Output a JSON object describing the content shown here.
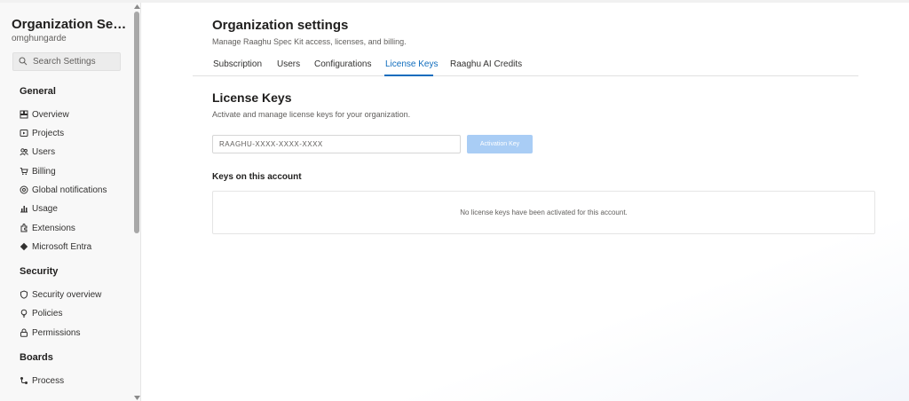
{
  "sidebar": {
    "org_title": "Organization Settin...",
    "org_subtitle": "omghungarde",
    "search_placeholder": "Search Settings",
    "sections": {
      "general": "General",
      "security": "Security",
      "boards": "Boards"
    },
    "general_items": [
      {
        "label": "Overview",
        "icon": "overview-icon"
      },
      {
        "label": "Projects",
        "icon": "projects-icon"
      },
      {
        "label": "Users",
        "icon": "users-icon"
      },
      {
        "label": "Billing",
        "icon": "billing-cart-icon"
      },
      {
        "label": "Global notifications",
        "icon": "notifications-icon"
      },
      {
        "label": "Usage",
        "icon": "usage-chart-icon"
      },
      {
        "label": "Extensions",
        "icon": "extensions-icon"
      },
      {
        "label": "Microsoft Entra",
        "icon": "entra-diamond-icon"
      }
    ],
    "security_items": [
      {
        "label": "Security overview",
        "icon": "shield-icon"
      },
      {
        "label": "Policies",
        "icon": "policies-bulb-icon"
      },
      {
        "label": "Permissions",
        "icon": "lock-icon"
      }
    ],
    "boards_items": [
      {
        "label": "Process",
        "icon": "process-icon"
      }
    ]
  },
  "header": {
    "title": "Organization settings",
    "description": "Manage Raaghu Spec Kit access, licenses, and billing."
  },
  "tabs": [
    {
      "label": "Subscription",
      "active": false
    },
    {
      "label": "Users",
      "active": false
    },
    {
      "label": "Configurations",
      "active": false
    },
    {
      "label": "License Keys",
      "active": true
    },
    {
      "label": "Raaghu AI Credits",
      "active": false
    }
  ],
  "license": {
    "title": "License Keys",
    "description": "Activate and manage license keys for your organization.",
    "input_placeholder": "RAAGHU-XXXX-XXXX-XXXX",
    "button_label": "Activation Key",
    "keys_title": "Keys on this account",
    "empty_message": "No license keys have been activated for this account."
  },
  "colors": {
    "accent": "#0f6cbd",
    "button_disabled": "#a9cdf5",
    "sidebar_bg": "#f8f8f8"
  }
}
